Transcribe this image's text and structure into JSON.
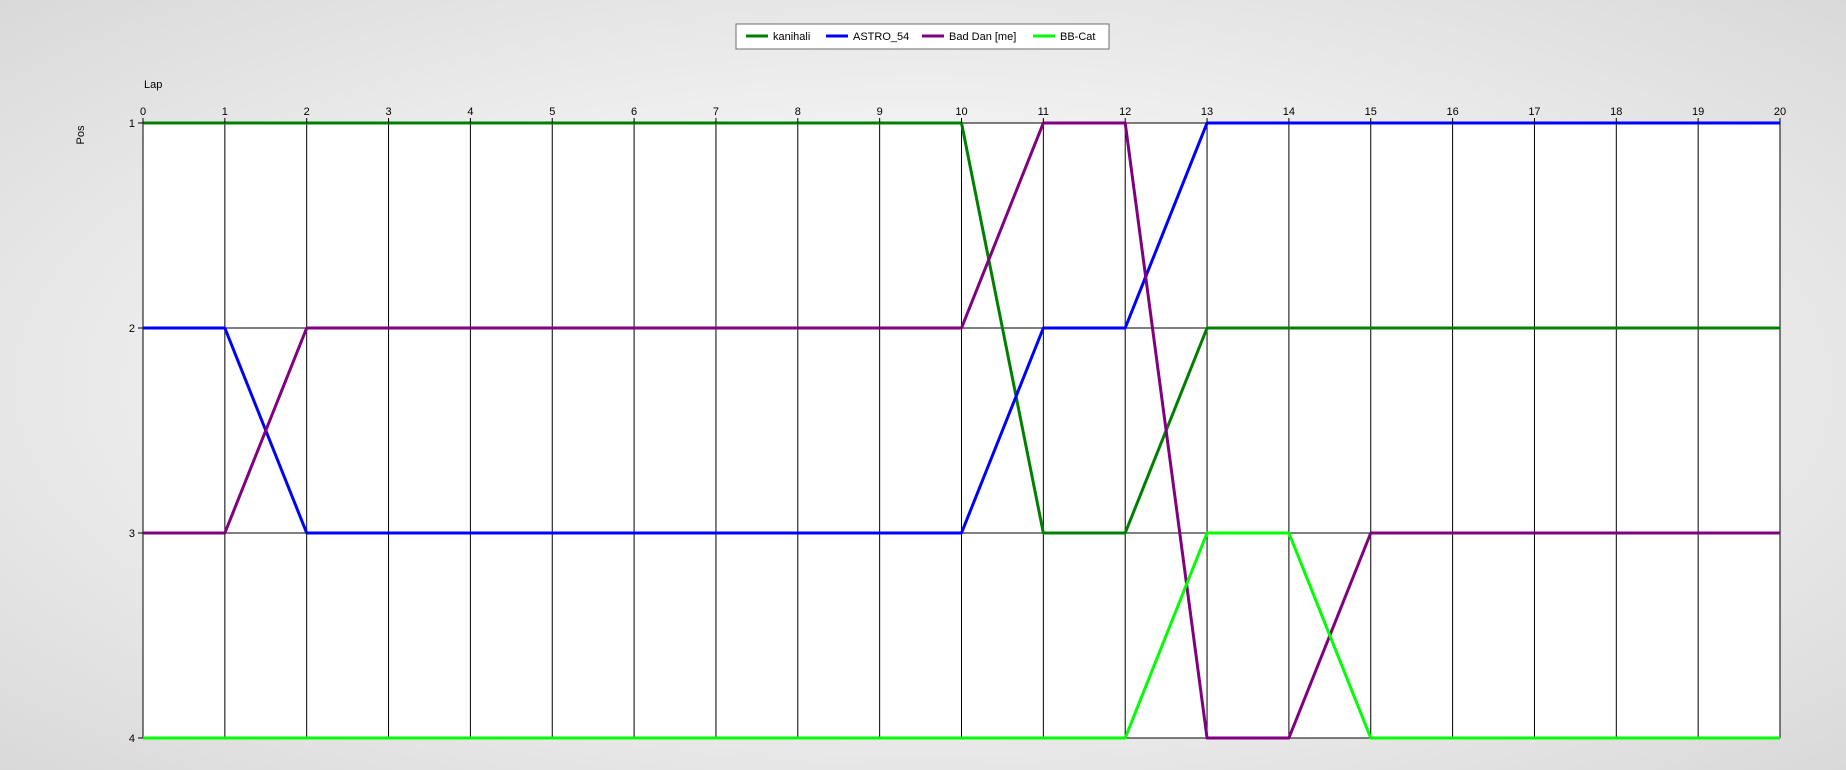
{
  "chart_data": {
    "type": "line",
    "xlabel": "Lap",
    "ylabel": "Pos",
    "xlim": [
      0,
      20
    ],
    "ylim": [
      1,
      4
    ],
    "y_inverted": true,
    "grid": true,
    "legend_position": "top-center",
    "x": [
      0,
      1,
      2,
      3,
      4,
      5,
      6,
      7,
      8,
      9,
      10,
      11,
      12,
      13,
      14,
      15,
      16,
      17,
      18,
      19,
      20
    ],
    "x_ticks": [
      "0",
      "1",
      "2",
      "3",
      "4",
      "5",
      "6",
      "7",
      "8",
      "9",
      "10",
      "11",
      "12",
      "13",
      "14",
      "15",
      "16",
      "17",
      "18",
      "19",
      "20"
    ],
    "y_ticks": [
      "1",
      "2",
      "3",
      "4"
    ],
    "series": [
      {
        "name": "kanihali",
        "color": "#008000",
        "values": [
          1,
          1,
          1,
          1,
          1,
          1,
          1,
          1,
          1,
          1,
          1,
          3,
          3,
          2,
          2,
          2,
          2,
          2,
          2,
          2,
          2
        ]
      },
      {
        "name": "ASTRO_54",
        "color": "#0000ff",
        "values": [
          2,
          2,
          3,
          3,
          3,
          3,
          3,
          3,
          3,
          3,
          3,
          2,
          2,
          1,
          1,
          1,
          1,
          1,
          1,
          1,
          1
        ]
      },
      {
        "name": "Bad Dan [me]",
        "color": "#800080",
        "values": [
          3,
          3,
          2,
          2,
          2,
          2,
          2,
          2,
          2,
          2,
          2,
          1,
          1,
          4,
          4,
          3,
          3,
          3,
          3,
          3,
          3
        ]
      },
      {
        "name": "BB-Cat",
        "color": "#00ff00",
        "values": [
          4,
          4,
          4,
          4,
          4,
          4,
          4,
          4,
          4,
          4,
          4,
          4,
          4,
          3,
          3,
          4,
          4,
          4,
          4,
          4,
          4
        ]
      }
    ]
  }
}
